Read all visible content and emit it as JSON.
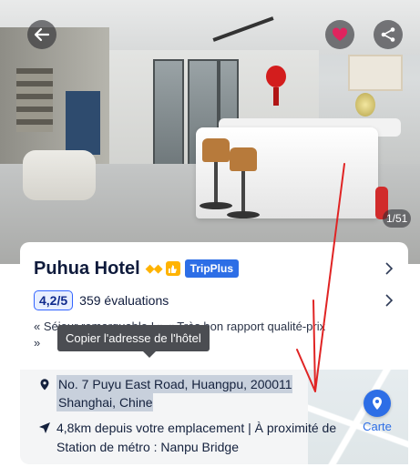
{
  "photo": {
    "counter": "1/51",
    "accent_red": "#d31d1d"
  },
  "hotel": {
    "name": "Puhua Hotel",
    "diamonds": "◆◆",
    "badge": "TripPlus"
  },
  "rating": {
    "score": "4,2",
    "scale": "/5",
    "reviews": "359 évaluations"
  },
  "quote": "« Séjour remarquable ! » « Très bon rapport qualité-prix »",
  "tooltip": "Copier l'adresse de l'hôtel",
  "address": {
    "line1": "No. 7 Puyu East Road, Huangpu, 200011",
    "line2": "Shanghai, Chine"
  },
  "distance": "4,8km depuis votre emplacement | À proximité de Station de métro : Nanpu Bridge",
  "map": {
    "label": "Carte"
  },
  "colors": {
    "primary": "#2d6ee6",
    "heart": "#e0245e",
    "annotation": "#e02424",
    "gold": "#ffb300"
  }
}
